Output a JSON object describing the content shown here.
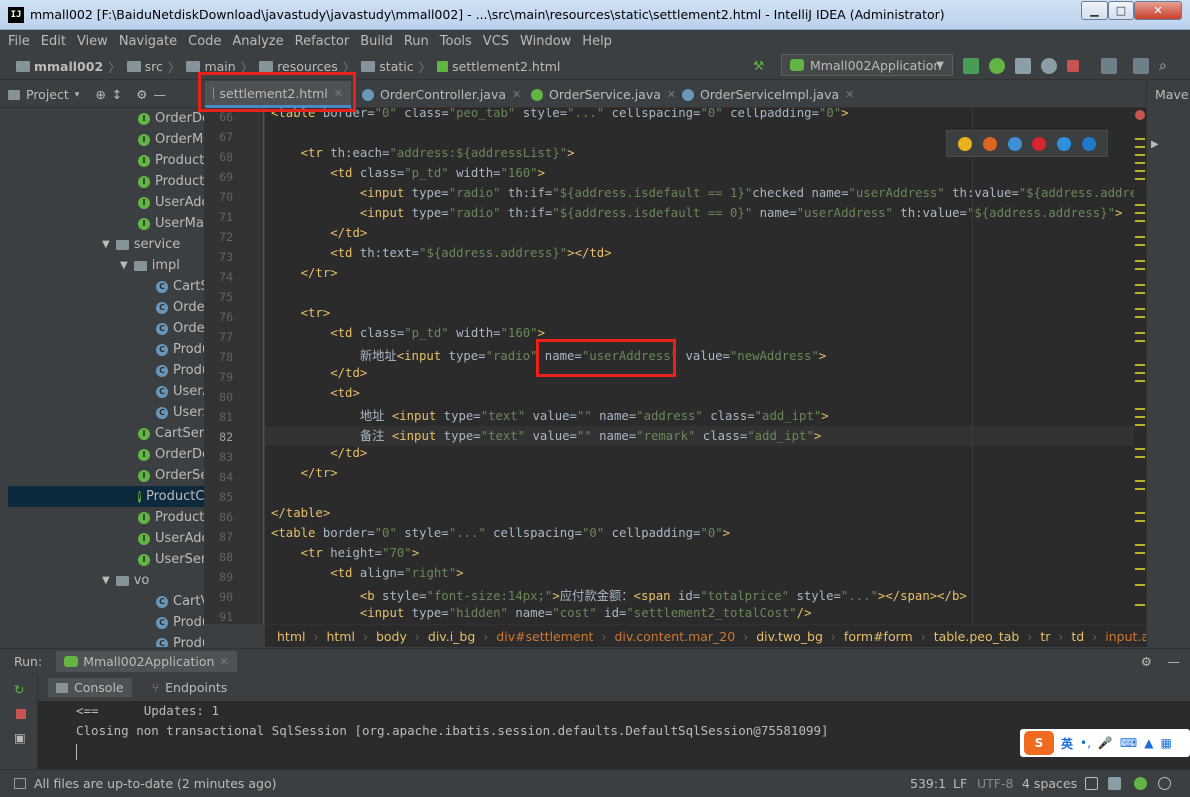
{
  "window": {
    "title": "mmall002 [F:\\BaiduNetdiskDownload\\javastudy\\javastudy\\mmall002] - ...\\src\\main\\resources\\static\\settlement2.html - IntelliJ IDEA (Administrator)",
    "app_icon": "IJ"
  },
  "menu": [
    "File",
    "Edit",
    "View",
    "Navigate",
    "Code",
    "Analyze",
    "Refactor",
    "Build",
    "Run",
    "Tools",
    "VCS",
    "Window",
    "Help"
  ],
  "breadcrumb": [
    "mmall002",
    "src",
    "main",
    "resources",
    "static",
    "settlement2.html"
  ],
  "run_config": "Mmall002Application",
  "project_header": "Project",
  "tabs": [
    {
      "label": "settlement2.html",
      "active": true
    },
    {
      "label": "OrderController.java"
    },
    {
      "label": "OrderService.java"
    },
    {
      "label": "OrderServiceImpl.java"
    }
  ],
  "maven_label": "Mave",
  "tree": [
    {
      "label": "OrderDe",
      "icon": "i"
    },
    {
      "label": "OrderMa",
      "icon": "i"
    },
    {
      "label": "ProductC",
      "icon": "i"
    },
    {
      "label": "ProductM",
      "icon": "i"
    },
    {
      "label": "UserAdd",
      "icon": "i"
    },
    {
      "label": "UserMap",
      "icon": "i"
    },
    {
      "label": "service",
      "icon": "p"
    },
    {
      "label": "impl",
      "icon": "p"
    },
    {
      "label": "CartS",
      "icon": "c"
    },
    {
      "label": "Orde",
      "icon": "c"
    },
    {
      "label": "Orde",
      "icon": "c"
    },
    {
      "label": "Produ",
      "icon": "c"
    },
    {
      "label": "Produ",
      "icon": "c"
    },
    {
      "label": "UserA",
      "icon": "c"
    },
    {
      "label": "UserS",
      "icon": "c"
    },
    {
      "label": "CartServ",
      "icon": "i"
    },
    {
      "label": "OrderDe",
      "icon": "i"
    },
    {
      "label": "OrderSe",
      "icon": "i"
    },
    {
      "label": "ProductC",
      "icon": "i",
      "selected": true
    },
    {
      "label": "ProductS",
      "icon": "i"
    },
    {
      "label": "UserAdd",
      "icon": "i"
    },
    {
      "label": "UserServ",
      "icon": "i"
    },
    {
      "label": "vo",
      "icon": "p"
    },
    {
      "label": "CartVO",
      "icon": "c"
    },
    {
      "label": "ProductC",
      "icon": "c"
    },
    {
      "label": "ProductV",
      "icon": "c"
    }
  ],
  "line_numbers": [
    "66",
    "67",
    "68",
    "69",
    "70",
    "71",
    "72",
    "73",
    "74",
    "75",
    "76",
    "77",
    "78",
    "79",
    "80",
    "81",
    "82",
    "83",
    "84",
    "85",
    "86",
    "87",
    "88",
    "89",
    "90",
    "91"
  ],
  "code": [
    "<table border=\"0\" class=\"peo_tab\" style=\"...\" cellspacing=\"0\" cellpadding=\"0\">",
    "",
    "    <tr th:each=\"address:${addressList}\">",
    "        <td class=\"p_td\" width=\"160\">",
    "            <input type=\"radio\" th:if=\"${address.isdefault == 1}\"checked name=\"userAddress\" th:value=\"${address.address}\">",
    "            <input type=\"radio\" th:if=\"${address.isdefault == 0}\" name=\"userAddress\" th:value=\"${address.address}\">",
    "        </td>",
    "        <td th:text=\"${address.address}\"></td>",
    "    </tr>",
    "",
    "    <tr>",
    "        <td class=\"p_td\" width=\"160\">",
    "            新地址<input type=\"radio\" name=\"userAddress\" value=\"newAddress\">",
    "        </td>",
    "        <td>",
    "            地址 <input type=\"text\" value=\"\" name=\"address\" class=\"add_ipt\">",
    "            备注 <input type=\"text\" value=\"\" name=\"remark\" class=\"add_ipt\">",
    "        </td>",
    "    </tr>",
    "",
    "</table>",
    "<table border=\"0\" style=\"...\" cellspacing=\"0\" cellpadding=\"0\">",
    "    <tr height=\"70\">",
    "        <td align=\"right\">",
    "            <b style=\"font-size:14px;\">应付款金额：<span id=\"totalprice\" style=\"...\"></span></b>",
    "            <input type=\"hidden\" name=\"cost\" id=\"settlement2_totalCost\"/>"
  ],
  "code_crumbs": [
    "html",
    "html",
    "body",
    "div.i_bg",
    "div#settlement",
    "div.content.mar_20",
    "div.two_bg",
    "form#form",
    "table.peo_tab",
    "tr",
    "td",
    "input.add_i"
  ],
  "run": {
    "label": "Run:",
    "config": "Mmall002Application",
    "subtabs": [
      "Console",
      "Endpoints"
    ],
    "console": [
      "<==      Updates: 1",
      "Closing non transactional SqlSession [org.apache.ibatis.session.defaults.DefaultSqlSession@75581099]",
      ""
    ]
  },
  "ime": {
    "logo": "S",
    "lang": "英"
  },
  "status": {
    "message": "All files are up-to-date (2 minutes ago)",
    "position": "539:1",
    "line_sep": "LF",
    "encoding": "UTF-8",
    "indent": "4 spaces"
  },
  "colors": {
    "highlight": "#e8211b",
    "tag": "#e8bf6a",
    "string": "#6a8759",
    "selection": "#0d293e"
  }
}
